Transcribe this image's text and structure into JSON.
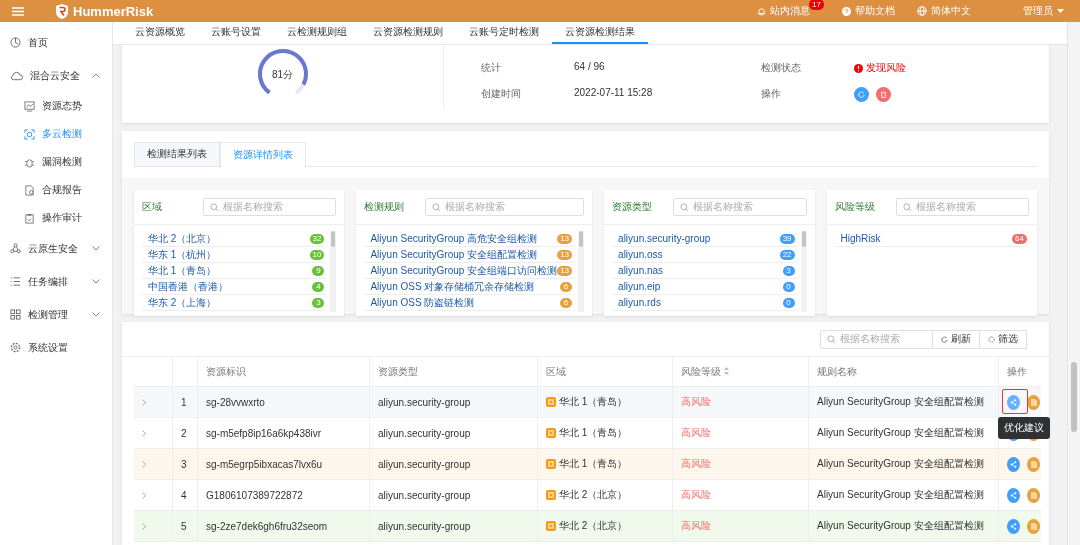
{
  "header": {
    "logo": "HummerRisk",
    "messages": "站内消息",
    "message_count": "17",
    "help": "帮助文档",
    "language": "简体中文",
    "user": "管理员"
  },
  "sidebar": {
    "items": [
      {
        "label": "首页"
      },
      {
        "label": "混合云安全",
        "expanded": true,
        "children": [
          {
            "label": "资源态势",
            "selected": false
          },
          {
            "label": "多云检测",
            "selected": true
          },
          {
            "label": "漏洞检测",
            "selected": false
          },
          {
            "label": "合规报告",
            "selected": false
          },
          {
            "label": "操作审计",
            "selected": false
          }
        ]
      },
      {
        "label": "云原生安全",
        "expanded": false
      },
      {
        "label": "任务编排",
        "expanded": false
      },
      {
        "label": "检测管理",
        "expanded": false
      },
      {
        "label": "系统设置"
      }
    ]
  },
  "tabs": [
    {
      "label": "云资源概览",
      "selected": false
    },
    {
      "label": "云账号设置",
      "selected": false
    },
    {
      "label": "云检测规则组",
      "selected": false
    },
    {
      "label": "云资源检测规则",
      "selected": false
    },
    {
      "label": "云账号定时检测",
      "selected": false
    },
    {
      "label": "云资源检测结果",
      "selected": true
    }
  ],
  "summary": {
    "score": "81分",
    "level": 0.9,
    "left_fields": [
      {
        "label": "统计",
        "value": "64 / 96"
      },
      {
        "label": "创建时间",
        "value": "2022-07-11 15:28"
      }
    ],
    "status_label": "检测状态",
    "status": "发现风险",
    "actions_label": "操作"
  },
  "detail_tabs": [
    {
      "label": "检测结果列表",
      "selected": false
    },
    {
      "label": "资源详情列表",
      "selected": true
    }
  ],
  "filters": [
    {
      "title": "区域",
      "placeholder": "根据名称搜索",
      "color": "#67c23a",
      "items": [
        {
          "label": "华北 2（北京）",
          "count": "32"
        },
        {
          "label": "华东 1（杭州）",
          "count": "10"
        },
        {
          "label": "华北 1（青岛）",
          "count": "9"
        },
        {
          "label": "中国香港（香港）",
          "count": "4"
        },
        {
          "label": "华东 2（上海）",
          "count": "3"
        }
      ]
    },
    {
      "title": "检测规则",
      "placeholder": "根据名称搜索",
      "color": "#e6a23c",
      "items": [
        {
          "label": "Aliyun SecurityGroup 高危安全组检测",
          "count": "13"
        },
        {
          "label": "Aliyun SecurityGroup 安全组配置检测",
          "count": "13"
        },
        {
          "label": "Aliyun SecurityGroup 安全组端口访问检测",
          "count": "13"
        },
        {
          "label": "Aliyun OSS 对象存储桶冗余存储检测",
          "count": "6"
        },
        {
          "label": "Aliyun OSS 防盗链检测",
          "count": "6"
        }
      ]
    },
    {
      "title": "资源类型",
      "placeholder": "根据名称搜索",
      "color": "#409eff",
      "items": [
        {
          "label": "aliyun.security-group",
          "count": "39"
        },
        {
          "label": "aliyun.oss",
          "count": "22"
        },
        {
          "label": "aliyun.nas",
          "count": "3"
        },
        {
          "label": "aliyun.eip",
          "count": "0"
        },
        {
          "label": "aliyun.rds",
          "count": "0"
        }
      ]
    },
    {
      "title": "风险等级",
      "placeholder": "根据名称搜索",
      "color": "#f56c6c",
      "items": [
        {
          "label": "HighRisk",
          "count": "64"
        }
      ]
    }
  ],
  "table": {
    "search_placeholder": "根据名称搜索",
    "refresh": "刷新",
    "filter": "筛选",
    "columns": [
      "资源标识",
      "资源类型",
      "区域",
      "风险等级",
      "规则名称",
      "操作"
    ],
    "rows": [
      {
        "index": "1",
        "id": "sg-28vvwxrto",
        "type": "aliyun.security-group",
        "region": "华北 1（青岛）",
        "risk": "高风险",
        "rule": "Aliyun SecurityGroup 安全组配置检测",
        "color": "#f5f7fa",
        "outlined": true
      },
      {
        "index": "2",
        "id": "sg-m5efp8ip16a6kp438ivr",
        "type": "aliyun.security-group",
        "region": "华北 1（青岛）",
        "risk": "高风险",
        "rule": "Aliyun SecurityGroup 安全组配置检测",
        "color": "#ffffff",
        "outlined": false
      },
      {
        "index": "3",
        "id": "sg-m5egrp5ibxacas7lvx6u",
        "type": "aliyun.security-group",
        "region": "华北 1（青岛）",
        "risk": "高风险",
        "rule": "Aliyun SecurityGroup 安全组配置检测",
        "color": "#fdf6ec",
        "outlined": false
      },
      {
        "index": "4",
        "id": "G1806107389722872",
        "type": "aliyun.security-group",
        "region": "华北 2（北京）",
        "risk": "高风险",
        "rule": "Aliyun SecurityGroup 安全组配置检测",
        "color": "#ffffff",
        "outlined": false
      },
      {
        "index": "5",
        "id": "sg-2ze7dek6gh6fru32seom",
        "type": "aliyun.security-group",
        "region": "华北 2（北京）",
        "risk": "高风险",
        "rule": "Aliyun SecurityGroup 安全组配置检测",
        "color": "#f0f9eb",
        "outlined": false
      }
    ],
    "tooltip": "优化建议"
  }
}
